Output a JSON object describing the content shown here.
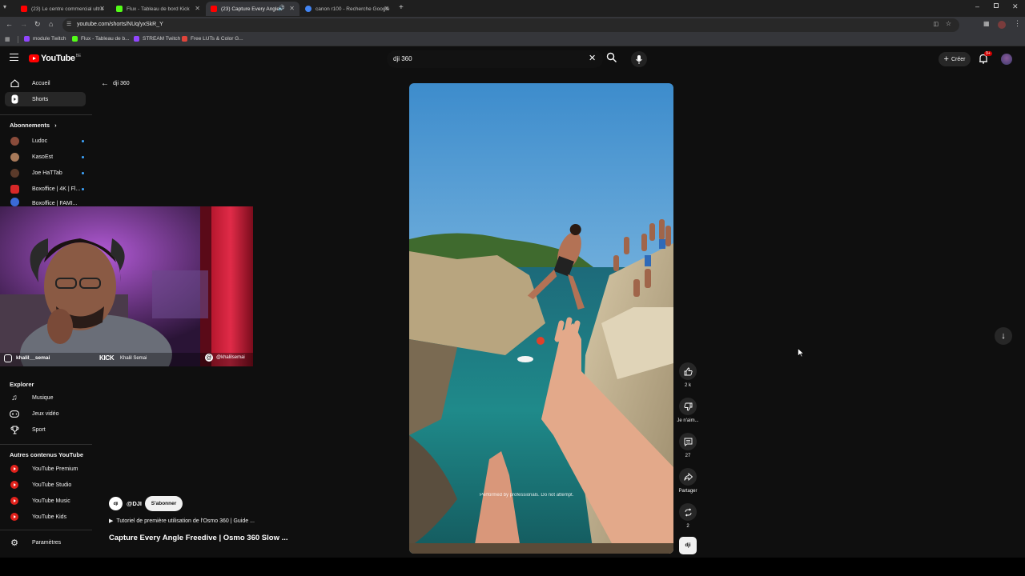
{
  "browser": {
    "tabs": [
      {
        "label": "(23) Le centre commercial ultra",
        "color": "#ff0000"
      },
      {
        "label": "Flux - Tableau de bord Kick",
        "color": "#53fc18"
      },
      {
        "label": "(23) Capture Every Angle F",
        "color": "#ff0000"
      },
      {
        "label": "canon r100 - Recherche Google",
        "color": "#4285f4"
      }
    ],
    "url": "youtube.com/shorts/NUq/yxSkR_Y",
    "bookmarks": [
      {
        "label": "module Twitch",
        "color": "#9146ff"
      },
      {
        "label": "Flux - Tableau de b...",
        "color": "#53fc18"
      },
      {
        "label": "STREAM Twitch",
        "color": "#9146ff"
      },
      {
        "label": "Free LUTs & Color G...",
        "color": "#e0443a"
      }
    ],
    "notif_count": "9+"
  },
  "header": {
    "logo_text": "YouTube",
    "logo_country": "BE",
    "search_value": "dji 360",
    "create_label": "Créer"
  },
  "sidebar": {
    "home": "Accueil",
    "shorts": "Shorts",
    "subs_title": "Abonnements",
    "subs": [
      {
        "name": "Ludoc",
        "color": "#8a4b3a"
      },
      {
        "name": "KasoEst",
        "color": "#a87a5a"
      },
      {
        "name": "Joe HaTTab",
        "color": "#5a3a2a"
      },
      {
        "name": "Boxoffice | 4K | Fl...",
        "color": "#d62828"
      },
      {
        "name": "Boxoffice | FAMI...",
        "color": "#3a6ad6"
      }
    ],
    "explore_title": "Explorer",
    "explore": [
      "Musique",
      "Jeux vidéo",
      "Sport"
    ],
    "more_title": "Autres contenus YouTube",
    "more": [
      "YouTube Premium",
      "YouTube Studio",
      "YouTube Music",
      "YouTube Kids"
    ],
    "settings": "Paramètres"
  },
  "webcam": {
    "instagram": "khalil__semai",
    "kick_logo": "KICK",
    "kick_user": "Khalil Semai",
    "threads": "@khalilsemai"
  },
  "shorts": {
    "back_label": "dji 360",
    "channel": "@DJI",
    "subscribe": "S'abonner",
    "playlist": "Tutoriel de première utilisation de l'Osmo 360 | Guide ...",
    "title": "Capture Every Angle Freedive | Osmo 360 Slow ...",
    "disclaimer": "Performed by professionals. Do not attempt.",
    "likes": "2 k",
    "dislike": "Je n'aim...",
    "comments": "27",
    "share": "Partager",
    "remix": "2"
  }
}
